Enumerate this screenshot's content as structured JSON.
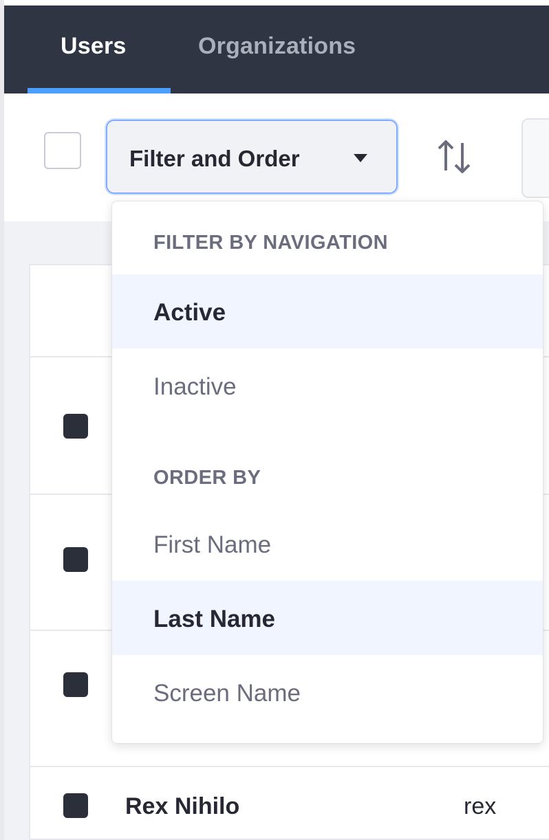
{
  "nav": {
    "tabs": [
      {
        "label": "Users"
      },
      {
        "label": "Organizations"
      }
    ]
  },
  "toolbar": {
    "filter_label": "Filter and Order"
  },
  "dropdown": {
    "sections": [
      {
        "header": "FILTER BY NAVIGATION",
        "items": [
          {
            "label": "Active",
            "selected": true
          },
          {
            "label": "Inactive",
            "selected": false
          }
        ]
      },
      {
        "header": "ORDER BY",
        "items": [
          {
            "label": "First Name",
            "selected": false
          },
          {
            "label": "Last Name",
            "selected": true
          },
          {
            "label": "Screen Name",
            "selected": false
          }
        ]
      }
    ]
  },
  "list": {
    "rows": [
      {
        "name": "Rex Nihilo",
        "screen_name": "rex"
      }
    ]
  },
  "colors": {
    "nav_bg": "#2f3542",
    "accent": "#4b9fff",
    "selected_item_bg": "#f0f5ff"
  }
}
